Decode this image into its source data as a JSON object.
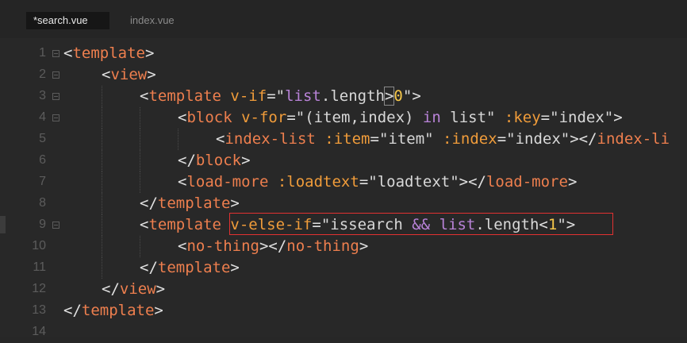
{
  "tabs": [
    {
      "label": "*search.vue",
      "active": true
    },
    {
      "label": "index.vue",
      "active": false
    }
  ],
  "line_numbers": [
    "1",
    "2",
    "3",
    "4",
    "5",
    "6",
    "7",
    "8",
    "9",
    "10",
    "11",
    "12",
    "13",
    "14"
  ],
  "code": {
    "l1": {
      "a": "<",
      "tag": "template",
      "b": ">"
    },
    "l2": {
      "a": "<",
      "tag": "view",
      "b": ">"
    },
    "l3": {
      "a": "<",
      "tag": "template",
      "sp": " ",
      "attr": "v-if",
      "eq": "=",
      "q1": "\"",
      "v1": "list",
      "dot": ".",
      "v2": "length",
      "op": ">",
      "num": "0",
      "q2": "\"",
      "b": ">"
    },
    "l4": {
      "a": "<",
      "tag": "block",
      "sp": " ",
      "attr": "v-for",
      "eq": "=",
      "v1": "\"(item,index) ",
      "kw": "in",
      "v2": " list\"",
      "sp2": " ",
      "attr2": ":key",
      "eq2": "=",
      "v3": "\"index\"",
      "b": ">"
    },
    "l5": {
      "a": "<",
      "tag": "index-list",
      "sp": " ",
      "attr": ":item",
      "eq": "=",
      "v1": "\"item\"",
      "sp2": " ",
      "attr2": ":index",
      "eq2": "=",
      "v2": "\"index\"",
      "c": "></",
      "tag2": "index-li"
    },
    "l6": {
      "a": "</",
      "tag": "block",
      "b": ">"
    },
    "l7": {
      "a": "<",
      "tag": "load-more",
      "sp": " ",
      "attr": ":loadtext",
      "eq": "=",
      "v1": "\"loadtext\"",
      "c": "></",
      "tag2": "load-more",
      "b": ">"
    },
    "l8": {
      "a": "</",
      "tag": "template",
      "b": ">"
    },
    "l9": {
      "a": "<",
      "tag": "template",
      "sp": " ",
      "attr": "v-else-if",
      "eq": "=",
      "v1": "\"issearch ",
      "kw": "&&",
      "sp2": " ",
      "v2": "list",
      "dot": ".",
      "v3": "length",
      "op": "<",
      "num": "1",
      "q2": "\"",
      "b": ">"
    },
    "l10": {
      "a": "<",
      "tag": "no-thing",
      "c": "></",
      "tag2": "no-thing",
      "b": ">"
    },
    "l11": {
      "a": "</",
      "tag": "template",
      "b": ">"
    },
    "l12": {
      "a": "</",
      "tag": "view",
      "b": ">"
    },
    "l13": {
      "a": "</",
      "tag": "template",
      "b": ">"
    }
  }
}
